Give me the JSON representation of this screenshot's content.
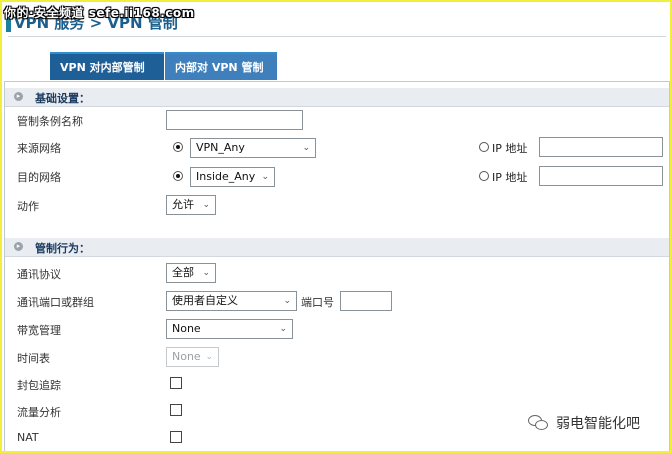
{
  "header": {
    "title": "VPN 服务 > VPN 管制",
    "watermark": "你的·安全频道 sefe.ii168.com"
  },
  "tabs": [
    {
      "label": "VPN 对内部管制",
      "active": true
    },
    {
      "label": "内部对 VPN 管制",
      "active": false
    }
  ],
  "basic_settings": {
    "title": "基础设置：",
    "rule_name": {
      "label": "管制条例名称",
      "value": ""
    },
    "source_network": {
      "label": "来源网络",
      "select_value": "VPN_Any",
      "selected_mode": "network",
      "ip_option_label": "IP 地址",
      "ip_value": ""
    },
    "destination_network": {
      "label": "目的网络",
      "select_value": "Inside_Any",
      "selected_mode": "network",
      "ip_option_label": "IP 地址",
      "ip_value": ""
    },
    "action": {
      "label": "动作",
      "value": "允许"
    }
  },
  "control_behavior": {
    "title": "管制行为：",
    "protocol": {
      "label": "通讯协议",
      "value": "全部"
    },
    "port_group": {
      "label": "通讯端口或群组",
      "value": "使用者自定义",
      "port_label": "端口号",
      "port_value": ""
    },
    "bandwidth": {
      "label": "带宽管理",
      "value": "None"
    },
    "schedule": {
      "label": "时间表",
      "value": "None",
      "disabled": true
    },
    "packet_trace": {
      "label": "封包追踪",
      "checked": false
    },
    "traffic_analysis": {
      "label": "流量分析",
      "checked": false
    },
    "nat": {
      "label": "NAT",
      "checked": false
    }
  },
  "watermark_footer": {
    "text": "弱电智能化吧",
    "icon": "wechat-icon"
  },
  "colors": {
    "tab_active": "#1f5f98",
    "tab_inactive": "#3f7fbc",
    "section_bg": "#e9edf1",
    "frame_border": "#f2ee3a",
    "title_color": "#1d5f8c"
  }
}
